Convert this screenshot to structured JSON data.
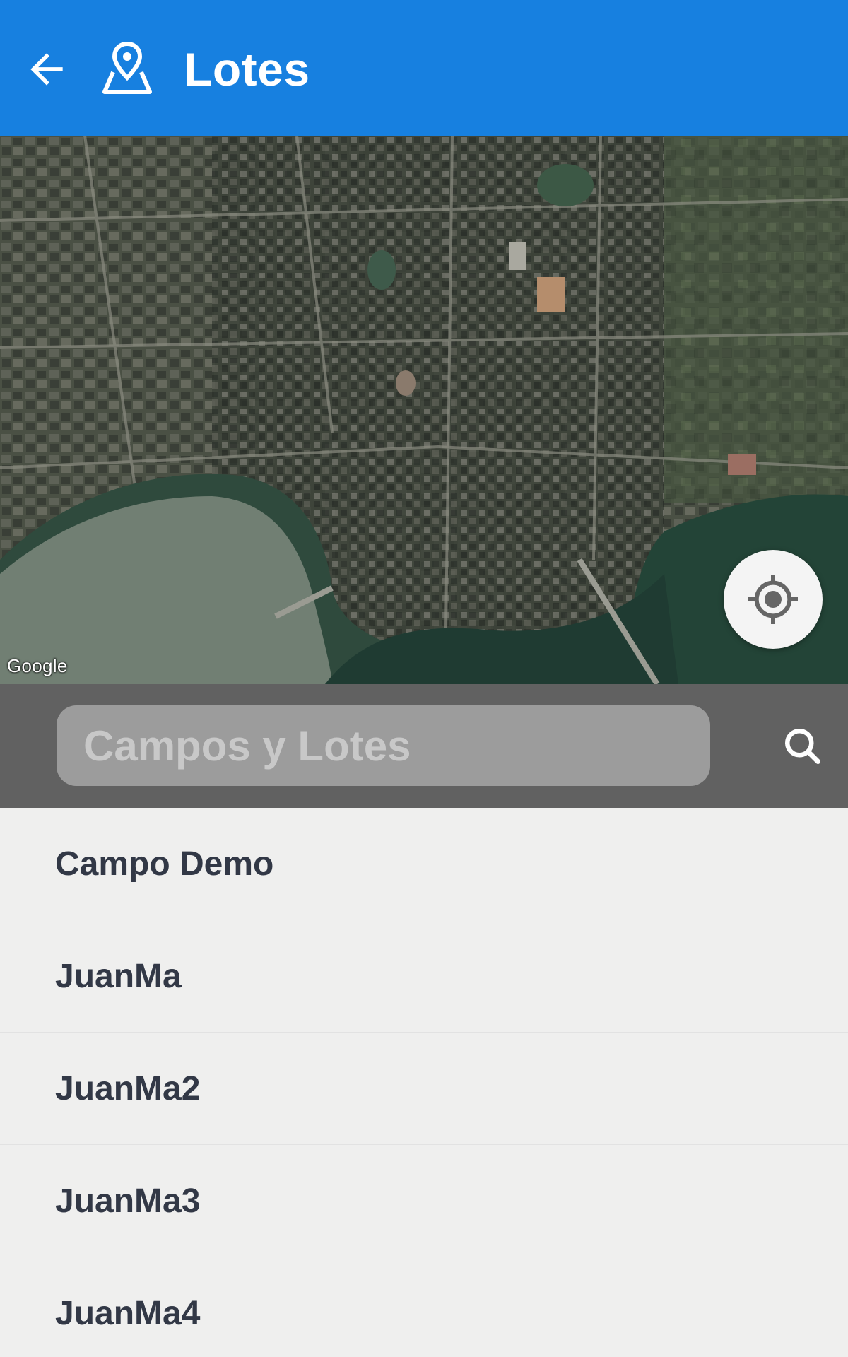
{
  "header": {
    "title": "Lotes",
    "back_icon": "arrow-left-icon",
    "title_icon": "map-pin-icon",
    "background_color": "#1780e0"
  },
  "map": {
    "attribution": "Google",
    "locate_icon": "my-location-icon"
  },
  "search": {
    "placeholder": "Campos y Lotes",
    "value": "",
    "icon": "search-icon"
  },
  "list": {
    "items": [
      {
        "label": "Campo Demo"
      },
      {
        "label": "JuanMa"
      },
      {
        "label": "JuanMa2"
      },
      {
        "label": "JuanMa3"
      },
      {
        "label": "JuanMa4"
      }
    ]
  }
}
